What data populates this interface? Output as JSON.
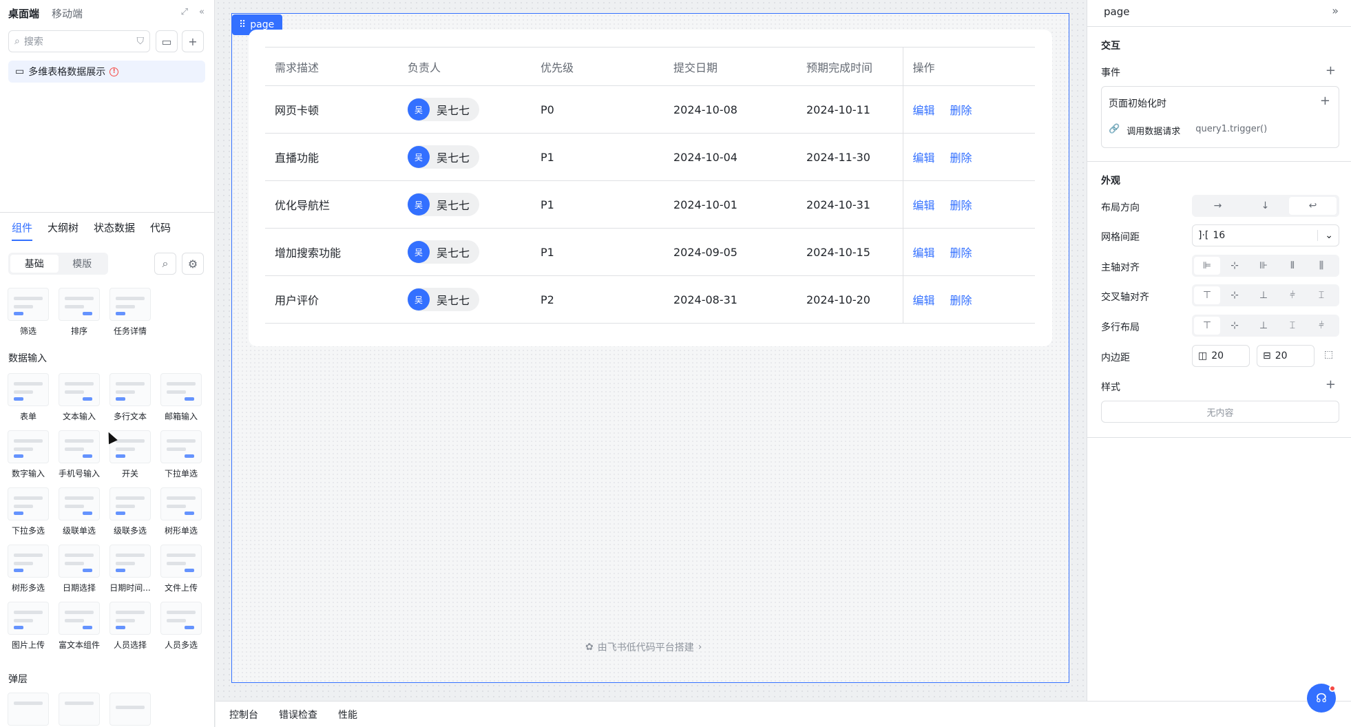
{
  "left": {
    "tabs": [
      "桌面端",
      "移动端"
    ],
    "search_placeholder": "搜索",
    "page_item": "多维表格数据展示",
    "panel_tabs": [
      "组件",
      "大纲树",
      "状态数据",
      "代码"
    ],
    "segments": [
      "基础",
      "模版"
    ],
    "top_components": [
      "筛选",
      "排序",
      "任务详情"
    ],
    "section_input": "数据输入",
    "input_components": [
      "表单",
      "文本输入",
      "多行文本",
      "邮箱输入",
      "数字输入",
      "手机号输入",
      "开关",
      "下拉单选",
      "下拉多选",
      "级联单选",
      "级联多选",
      "树形单选",
      "树形多选",
      "日期选择",
      "日期时间...",
      "文件上传",
      "图片上传",
      "富文本组件",
      "人员选择",
      "人员多选"
    ],
    "section_popup": "弹层"
  },
  "canvas": {
    "page_tag": "page",
    "columns": [
      "需求描述",
      "负责人",
      "优先级",
      "提交日期",
      "预期完成时间",
      "操作"
    ],
    "rows": [
      {
        "desc": "网页卡顿",
        "owner_avatar": "吴",
        "owner": "吴七七",
        "priority": "P0",
        "submit": "2024-10-08",
        "due": "2024-10-11"
      },
      {
        "desc": "直播功能",
        "owner_avatar": "吴",
        "owner": "吴七七",
        "priority": "P1",
        "submit": "2024-10-04",
        "due": "2024-11-30"
      },
      {
        "desc": "优化导航栏",
        "owner_avatar": "吴",
        "owner": "吴七七",
        "priority": "P1",
        "submit": "2024-10-01",
        "due": "2024-10-31"
      },
      {
        "desc": "增加搜索功能",
        "owner_avatar": "吴",
        "owner": "吴七七",
        "priority": "P1",
        "submit": "2024-09-05",
        "due": "2024-10-15"
      },
      {
        "desc": "用户评价",
        "owner_avatar": "吴",
        "owner": "吴七七",
        "priority": "P2",
        "submit": "2024-08-31",
        "due": "2024-10-20"
      }
    ],
    "edit_label": "编辑",
    "delete_label": "删除",
    "footer_note": "由飞书低代码平台搭建"
  },
  "bottom": {
    "tabs": [
      "控制台",
      "错误检查",
      "性能"
    ]
  },
  "right": {
    "title": "page",
    "interaction": "交互",
    "events": "事件",
    "event_name": "页面初始化时",
    "action_label": "调用数据请求",
    "action_value": "query1.trigger()",
    "appearance": "外观",
    "layout_direction": "布局方向",
    "grid_gap": "网格间距",
    "grid_gap_value": "16",
    "main_axis": "主轴对齐",
    "cross_axis": "交叉轴对齐",
    "multi_line": "多行布局",
    "padding": "内边距",
    "padding_h": "20",
    "padding_v": "20",
    "style": "样式",
    "empty": "无内容"
  },
  "colors": {
    "accent": "#3370ff",
    "danger": "#f54a45"
  }
}
